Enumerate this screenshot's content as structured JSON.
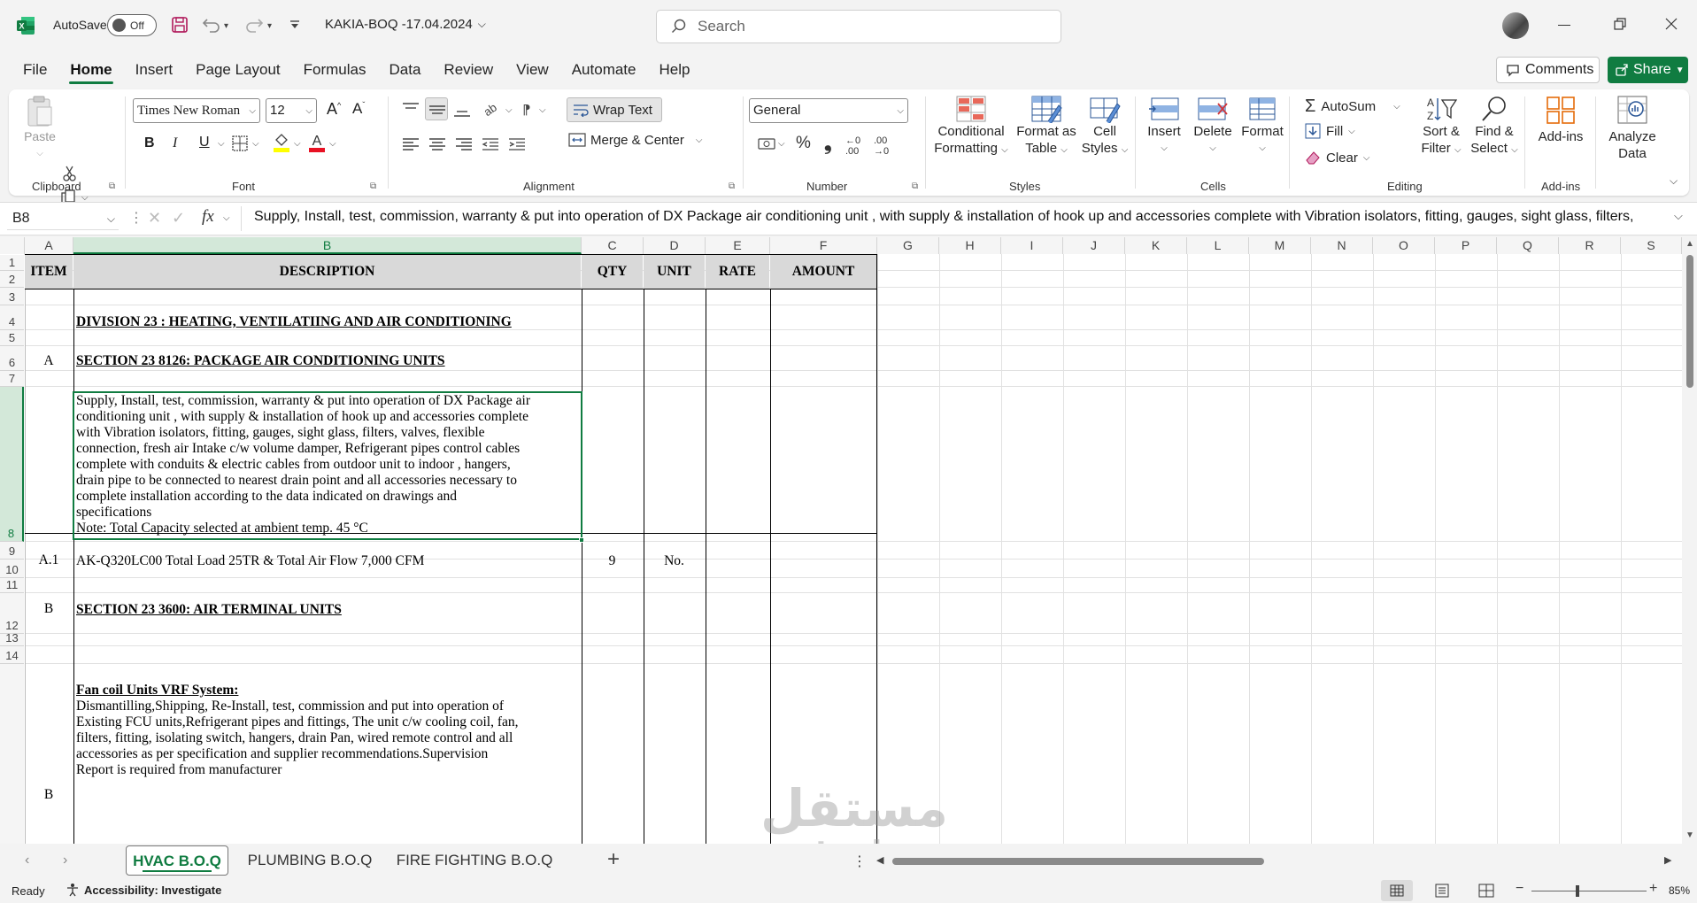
{
  "app": {
    "autosave_label": "AutoSave",
    "autosave_state": "Off",
    "file_title": "KAKIA-BOQ -17.04.2024",
    "search_placeholder": "Search",
    "brand_color": "#107c41"
  },
  "menu": [
    "File",
    "Home",
    "Insert",
    "Page Layout",
    "Formulas",
    "Data",
    "Review",
    "View",
    "Automate",
    "Help"
  ],
  "actions": {
    "comments": "Comments",
    "share": "Share"
  },
  "ribbon": {
    "clipboard": {
      "paste": "Paste",
      "label": "Clipboard"
    },
    "font": {
      "name": "Times New Roman",
      "size": "12",
      "label": "Font"
    },
    "alignment": {
      "wrap": "Wrap Text",
      "merge": "Merge & Center",
      "label": "Alignment"
    },
    "number": {
      "format": "General",
      "label": "Number"
    },
    "styles": {
      "cond": [
        "Conditional",
        "Formatting"
      ],
      "fmt_table": [
        "Format as",
        "Table"
      ],
      "cell_styles": [
        "Cell",
        "Styles"
      ],
      "label": "Styles"
    },
    "cells": {
      "insert": "Insert",
      "delete": "Delete",
      "format": "Format",
      "label": "Cells"
    },
    "editing": {
      "autosum": "AutoSum",
      "fill": "Fill",
      "clear": "Clear",
      "sort": [
        "Sort &",
        "Filter"
      ],
      "find": [
        "Find &",
        "Select"
      ],
      "label": "Editing"
    },
    "addins": {
      "addins": "Add-ins",
      "label": "Add-ins"
    },
    "analyze": {
      "label": [
        "Analyze",
        "Data"
      ]
    }
  },
  "formula_bar": {
    "name_box": "B8",
    "fx": "fx",
    "content": "Supply, Install, test, commission, warranty & put into operation of DX Package air conditioning unit , with  supply & installation of hook up and accessories complete with Vibration isolators, fitting, gauges, sight glass, filters,"
  },
  "columns": [
    "A",
    "B",
    "C",
    "D",
    "E",
    "F",
    "G",
    "H",
    "I",
    "J",
    "K",
    "L",
    "M",
    "N",
    "O",
    "P",
    "Q",
    "R",
    "S"
  ],
  "rows": [
    "1",
    "2",
    "3",
    "4",
    "5",
    "6",
    "7",
    "8",
    "9",
    "10",
    "11",
    "12",
    "13",
    "14"
  ],
  "headers": {
    "item": "ITEM",
    "desc": "DESCRIPTION",
    "qty": "QTY",
    "unit": "UNIT",
    "rate": "RATE",
    "amount": "AMOUNT"
  },
  "cells": {
    "r4_b": "DIVISION 23 : HEATING, VENTILATIING AND AIR CONDITIONING ",
    "r6_a": "A",
    "r6_b": "SECTION 23 8126: PACKAGE AIR CONDITIONING UNITS",
    "r8_b": [
      "Supply, Install, test, commission, warranty & put into operation of DX Package air",
      "conditioning unit , with  supply & installation of hook up and accessories complete",
      "with Vibration isolators, fitting, gauges, sight glass, filters, valves, flexible",
      "connection, fresh air Intake c/w volume damper,  Refrigerant pipes control cables",
      "complete with conduits & electric cables from outdoor unit  to indoor , hangers,",
      "drain pipe to be connected to nearest drain point and all accessories necessary to",
      "complete installation according to the data indicated on drawings and",
      "specifications",
      "Note: Total Capacity selected at ambient temp. 45 °C"
    ],
    "r10_a": "A.1",
    "r10_b": "AK-Q320LC00 Total Load 25TR &  Total Air Flow 7,000 CFM",
    "r10_c": "9",
    "r10_d": "No.",
    "r12_a": "B",
    "r12_b": "SECTION 23 3600: AIR TERMINAL UNITS",
    "r15_a": "B",
    "r15_title": "Fan coil Units VRF System:",
    "r15_b": [
      "Dismantilling,Shipping, Re-Install, test, commission and put into operation of",
      "Existing FCU units,Refrigerant pipes and fittings, The unit c/w cooling coil, fan,",
      "filters, fitting, isolating switch, hangers, drain Pan, wired remote control and all",
      "accessories as per specification and supplier recommendations.Supervision",
      "Report is required from manufacturer"
    ]
  },
  "sheets": [
    "HVAC B.O.Q",
    "PLUMBING B.O.Q",
    "FIRE FIGHTING B.O.Q"
  ],
  "status": {
    "ready": "Ready",
    "accessibility": "Accessibility: Investigate",
    "zoom": "85%"
  },
  "watermark": {
    "arabic": "مستقل",
    "latin": "mostaql.com"
  }
}
